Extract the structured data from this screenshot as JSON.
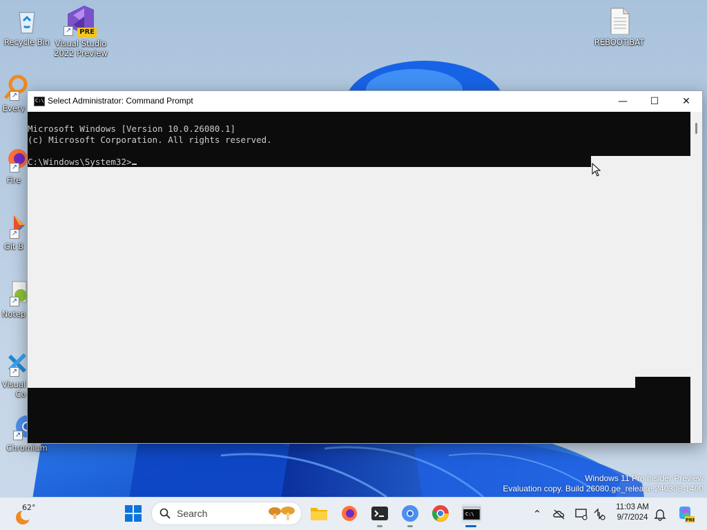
{
  "desktop": {
    "icons": [
      {
        "label": "Recycle Bin",
        "icon": "recycle-bin-icon"
      },
      {
        "label": "Visual Studio 2022 Preview",
        "badge": "PRE",
        "icon": "visual-studio-icon"
      },
      {
        "label": "REBOOT.BAT",
        "icon": "batch-file-icon"
      },
      {
        "label": "Every",
        "icon": "everything-search-icon"
      },
      {
        "label": "Fire",
        "icon": "firefox-icon"
      },
      {
        "label": "Git B",
        "icon": "git-bash-icon"
      },
      {
        "label": "Notep",
        "icon": "notepad-plus-plus-icon"
      },
      {
        "label": "Visual",
        "label2": "Co",
        "icon": "vscode-icon"
      },
      {
        "label": "Chromium",
        "icon": "chromium-icon"
      }
    ]
  },
  "window": {
    "title": "Select Administrator: Command Prompt",
    "controls": {
      "minimize": "—",
      "maximize": "☐",
      "close": "✕"
    },
    "console_lines": [
      "Microsoft Windows [Version 10.0.26080.1]",
      "(c) Microsoft Corporation. All rights reserved.",
      "",
      "C:\\Windows\\System32>"
    ]
  },
  "watermark": {
    "line1": "Windows 11 Pro Insider Preview",
    "line2": "Evaluation copy. Build 26080.ge_release.240308-1400"
  },
  "taskbar": {
    "weather_temp": "62°",
    "search_label": "Search",
    "clock_time": "11:03 AM",
    "clock_date": "9/7/2024"
  },
  "colors": {
    "console_bg": "#0c0c0c",
    "console_fg": "#cccccc",
    "accent": "#0067c0"
  }
}
